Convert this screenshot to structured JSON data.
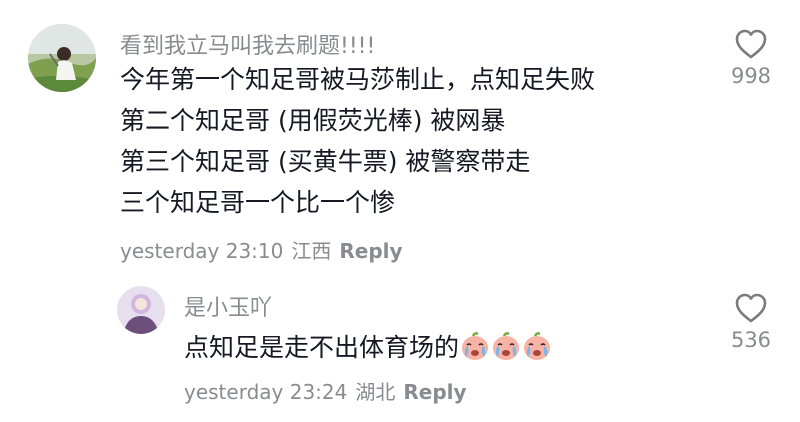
{
  "comments": [
    {
      "username": "看到我立马叫我去刷题!!!!",
      "lines": [
        "今年第一个知足哥被马莎制止，点知足失败",
        "第二个知足哥 (用假荧光棒) 被网暴",
        "第三个知足哥 (买黄牛票) 被警察带走",
        "三个知足哥一个比一个惨"
      ],
      "time": "yesterday 23:10",
      "location": "江西",
      "reply_label": "Reply",
      "likes": "998",
      "avatar_icon": "photo-avatar-icon"
    },
    {
      "username": "是小玉吖",
      "lines": [
        "点知足是走不出体育场的"
      ],
      "emojis": [
        "crying-face-icon",
        "crying-face-icon",
        "crying-face-icon"
      ],
      "time": "yesterday 23:24",
      "location": "湖北",
      "reply_label": "Reply",
      "likes": "536",
      "avatar_icon": "photo-avatar-icon"
    }
  ],
  "colors": {
    "text": "#161823",
    "muted": "#8a8b91",
    "heart_stroke": "#7b7c82"
  }
}
